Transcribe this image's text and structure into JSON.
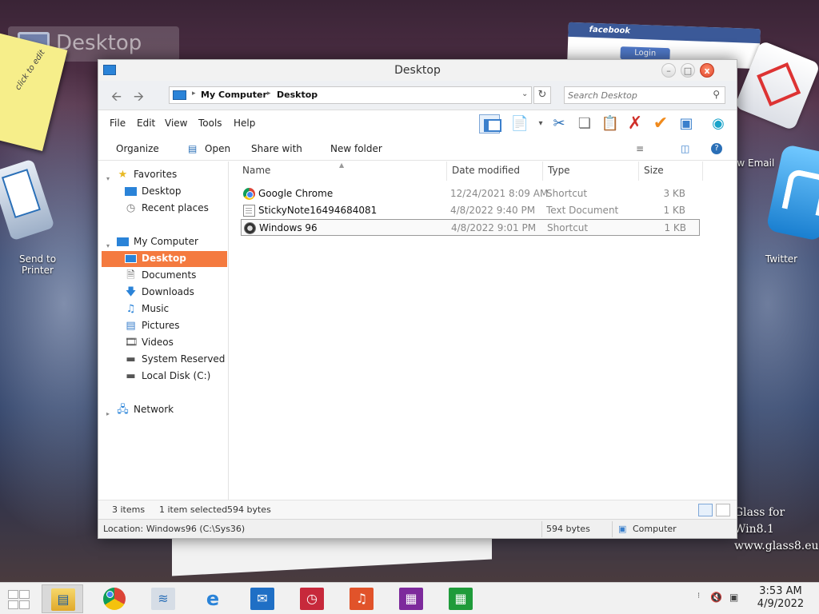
{
  "desktop": {
    "ghost_label": "Desktop",
    "sticky_text": "click to edit",
    "facebook": {
      "brand": "facebook",
      "login": "Login"
    },
    "icons": [
      {
        "label": "Send to\nPrinter"
      },
      {
        "label": "ew Email"
      },
      {
        "label": "Twitter"
      }
    ],
    "watermark": [
      "Glass for Win8.1",
      "www.glass8.eu"
    ]
  },
  "window": {
    "title": "Desktop",
    "controls": {
      "minimize": "–",
      "maximize": "□",
      "close": "x"
    },
    "address": {
      "crumbs": [
        "My Computer",
        "Desktop"
      ],
      "search_placeholder": "Search Desktop"
    },
    "menu": [
      "File",
      "Edit",
      "View",
      "Tools",
      "Help"
    ],
    "commands": {
      "organize": "Organize",
      "open": "Open",
      "share": "Share with",
      "new_folder": "New folder"
    },
    "sidebar": {
      "favorites": {
        "label": "Favorites",
        "items": [
          "Desktop",
          "Recent places"
        ]
      },
      "computer": {
        "label": "My Computer",
        "items": [
          "Desktop",
          "Documents",
          "Downloads",
          "Music",
          "Pictures",
          "Videos",
          "System Reserved (B:)",
          "Local Disk (C:)"
        ]
      },
      "network": "Network"
    },
    "columns": [
      "Name",
      "Date modified",
      "Type",
      "Size"
    ],
    "files": [
      {
        "name": "Google Chrome",
        "date": "12/24/2021 8:09 AM",
        "type": "Shortcut",
        "size": "3 KB",
        "icon": "chrome-icon"
      },
      {
        "name": "StickyNote16494684081",
        "date": "4/8/2022 9:40 PM",
        "type": "Text Document",
        "size": "1 KB",
        "icon": "text-file-icon"
      },
      {
        "name": "Windows 96",
        "date": "4/8/2022 9:01 PM",
        "type": "Shortcut",
        "size": "1 KB",
        "icon": "windows96-icon",
        "selected": true
      }
    ],
    "status": {
      "count": "3 items",
      "selection": "1 item selected",
      "sel_size": "594 bytes",
      "location": "Location: Windows96 (C:\\Sys36)",
      "size": "594 bytes",
      "zone": "Computer"
    }
  },
  "taskbar": {
    "apps": [
      "file-explorer",
      "chrome",
      "task-manager",
      "internet-explorer",
      "mail",
      "alarms",
      "music",
      "store-purple",
      "store"
    ],
    "clock": {
      "time": "3:53 AM",
      "date": "4/9/2022"
    }
  },
  "colors": {
    "selection": "#f47a3f",
    "accent": "#2a83d8"
  }
}
